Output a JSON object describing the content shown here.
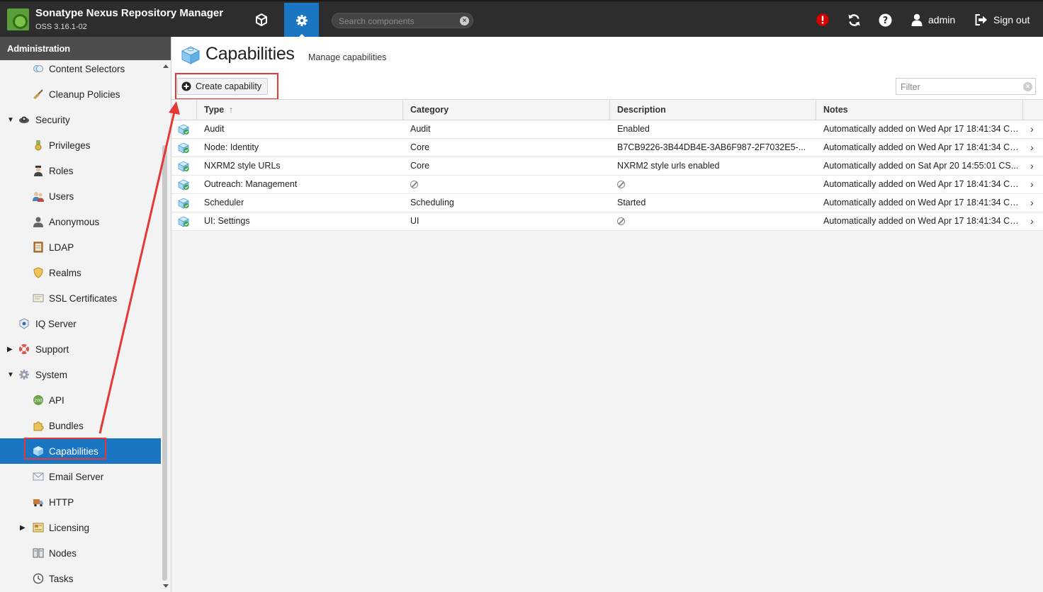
{
  "header": {
    "app_name": "Sonatype Nexus Repository Manager",
    "version": "OSS 3.16.1-02",
    "search_placeholder": "Search components",
    "user_label": "admin",
    "signout_label": "Sign out"
  },
  "sidebar": {
    "title": "Administration",
    "items": [
      {
        "label": "Content Selectors",
        "icon": "content-selectors-icon"
      },
      {
        "label": "Cleanup Policies",
        "icon": "broom-icon"
      },
      {
        "label": "Security",
        "icon": "security-icon"
      },
      {
        "label": "Privileges",
        "icon": "medal-icon"
      },
      {
        "label": "Roles",
        "icon": "role-icon"
      },
      {
        "label": "Users",
        "icon": "users-icon"
      },
      {
        "label": "Anonymous",
        "icon": "anonymous-user-icon"
      },
      {
        "label": "LDAP",
        "icon": "address-book-icon"
      },
      {
        "label": "Realms",
        "icon": "shield-icon"
      },
      {
        "label": "SSL Certificates",
        "icon": "certificate-icon"
      },
      {
        "label": "IQ Server",
        "icon": "iq-server-icon"
      },
      {
        "label": "Support",
        "icon": "lifebuoy-icon"
      },
      {
        "label": "System",
        "icon": "gear-icon"
      },
      {
        "label": "API",
        "icon": "api-icon"
      },
      {
        "label": "Bundles",
        "icon": "puzzle-icon"
      },
      {
        "label": "Capabilities",
        "icon": "capabilities-icon"
      },
      {
        "label": "Email Server",
        "icon": "envelope-icon"
      },
      {
        "label": "HTTP",
        "icon": "truck-icon"
      },
      {
        "label": "Licensing",
        "icon": "license-icon"
      },
      {
        "label": "Nodes",
        "icon": "nodes-icon"
      },
      {
        "label": "Tasks",
        "icon": "clock-icon"
      }
    ],
    "selected": "Capabilities"
  },
  "main": {
    "title": "Capabilities",
    "subtitle": "Manage capabilities",
    "create_label": "Create capability",
    "filter_placeholder": "Filter",
    "columns": [
      "Type",
      "Category",
      "Description",
      "Notes"
    ],
    "rows": [
      {
        "type": "Audit",
        "category": "Audit",
        "description": "Enabled",
        "notes": "Automatically added on Wed Apr 17 18:41:34 CS..."
      },
      {
        "type": "Node: Identity",
        "category": "Core",
        "description": "B7CB9226-3B44DB4E-3AB6F987-2F7032E5-...",
        "notes": "Automatically added on Wed Apr 17 18:41:34 CS..."
      },
      {
        "type": "NXRM2 style URLs",
        "category": "Core",
        "description": "NXRM2 style urls enabled",
        "notes": "Automatically added on Sat Apr 20 14:55:01 CS..."
      },
      {
        "type": "Outreach: Management",
        "category": "",
        "description": "",
        "notes": "Automatically added on Wed Apr 17 18:41:34 CS..."
      },
      {
        "type": "Scheduler",
        "category": "Scheduling",
        "description": "Started",
        "notes": "Automatically added on Wed Apr 17 18:41:34 CS..."
      },
      {
        "type": "UI: Settings",
        "category": "UI",
        "description": "",
        "notes": "Automatically added on Wed Apr 17 18:41:34 CS..."
      }
    ]
  },
  "colors": {
    "accent": "#1a76c2",
    "header_bg": "#2d2d2d",
    "annotation": "#e53935",
    "alert": "#d50000"
  }
}
